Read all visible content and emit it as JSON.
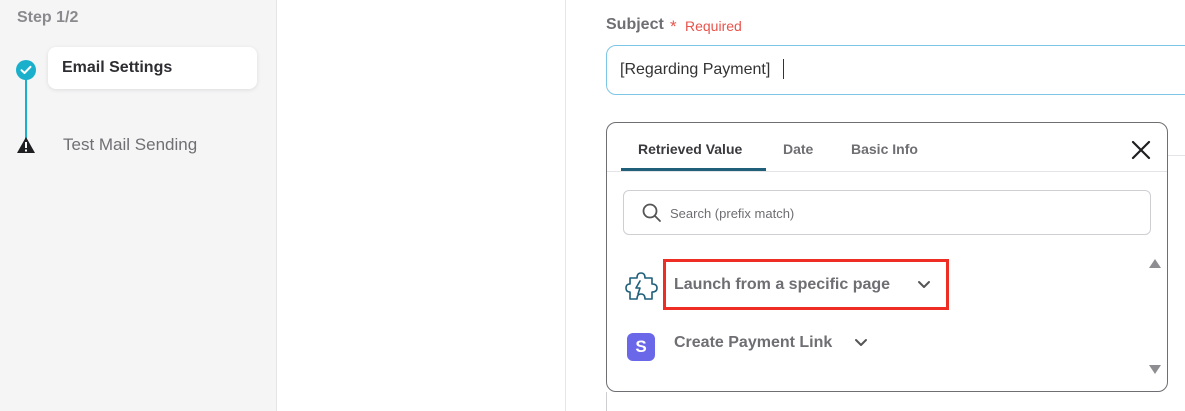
{
  "sidebar": {
    "step_label": "Step 1/2",
    "steps": [
      {
        "label": "Email Settings",
        "state": "completed"
      },
      {
        "label": "Test Mail Sending",
        "state": "warning"
      }
    ]
  },
  "form": {
    "subject_label": "Subject",
    "required_star": "*",
    "required_text": "Required",
    "subject_value": "[Regarding Payment]"
  },
  "popover": {
    "tabs": [
      {
        "label": "Retrieved Value",
        "active": true
      },
      {
        "label": "Date",
        "active": false
      },
      {
        "label": "Basic Info",
        "active": false
      }
    ],
    "search_placeholder": "Search (prefix match)",
    "items": [
      {
        "label": "Launch from a specific page",
        "icon": "puzzle-icon",
        "highlighted": true
      },
      {
        "label": "Create Payment Link",
        "icon": "stripe-icon",
        "badge": "S",
        "highlighted": false
      }
    ]
  },
  "colors": {
    "accent": "#1ab0cc",
    "required": "#e8544b",
    "tab_underline": "#1f5f7a",
    "highlight_box": "#ee2e24",
    "stripe": "#6a68e8"
  }
}
